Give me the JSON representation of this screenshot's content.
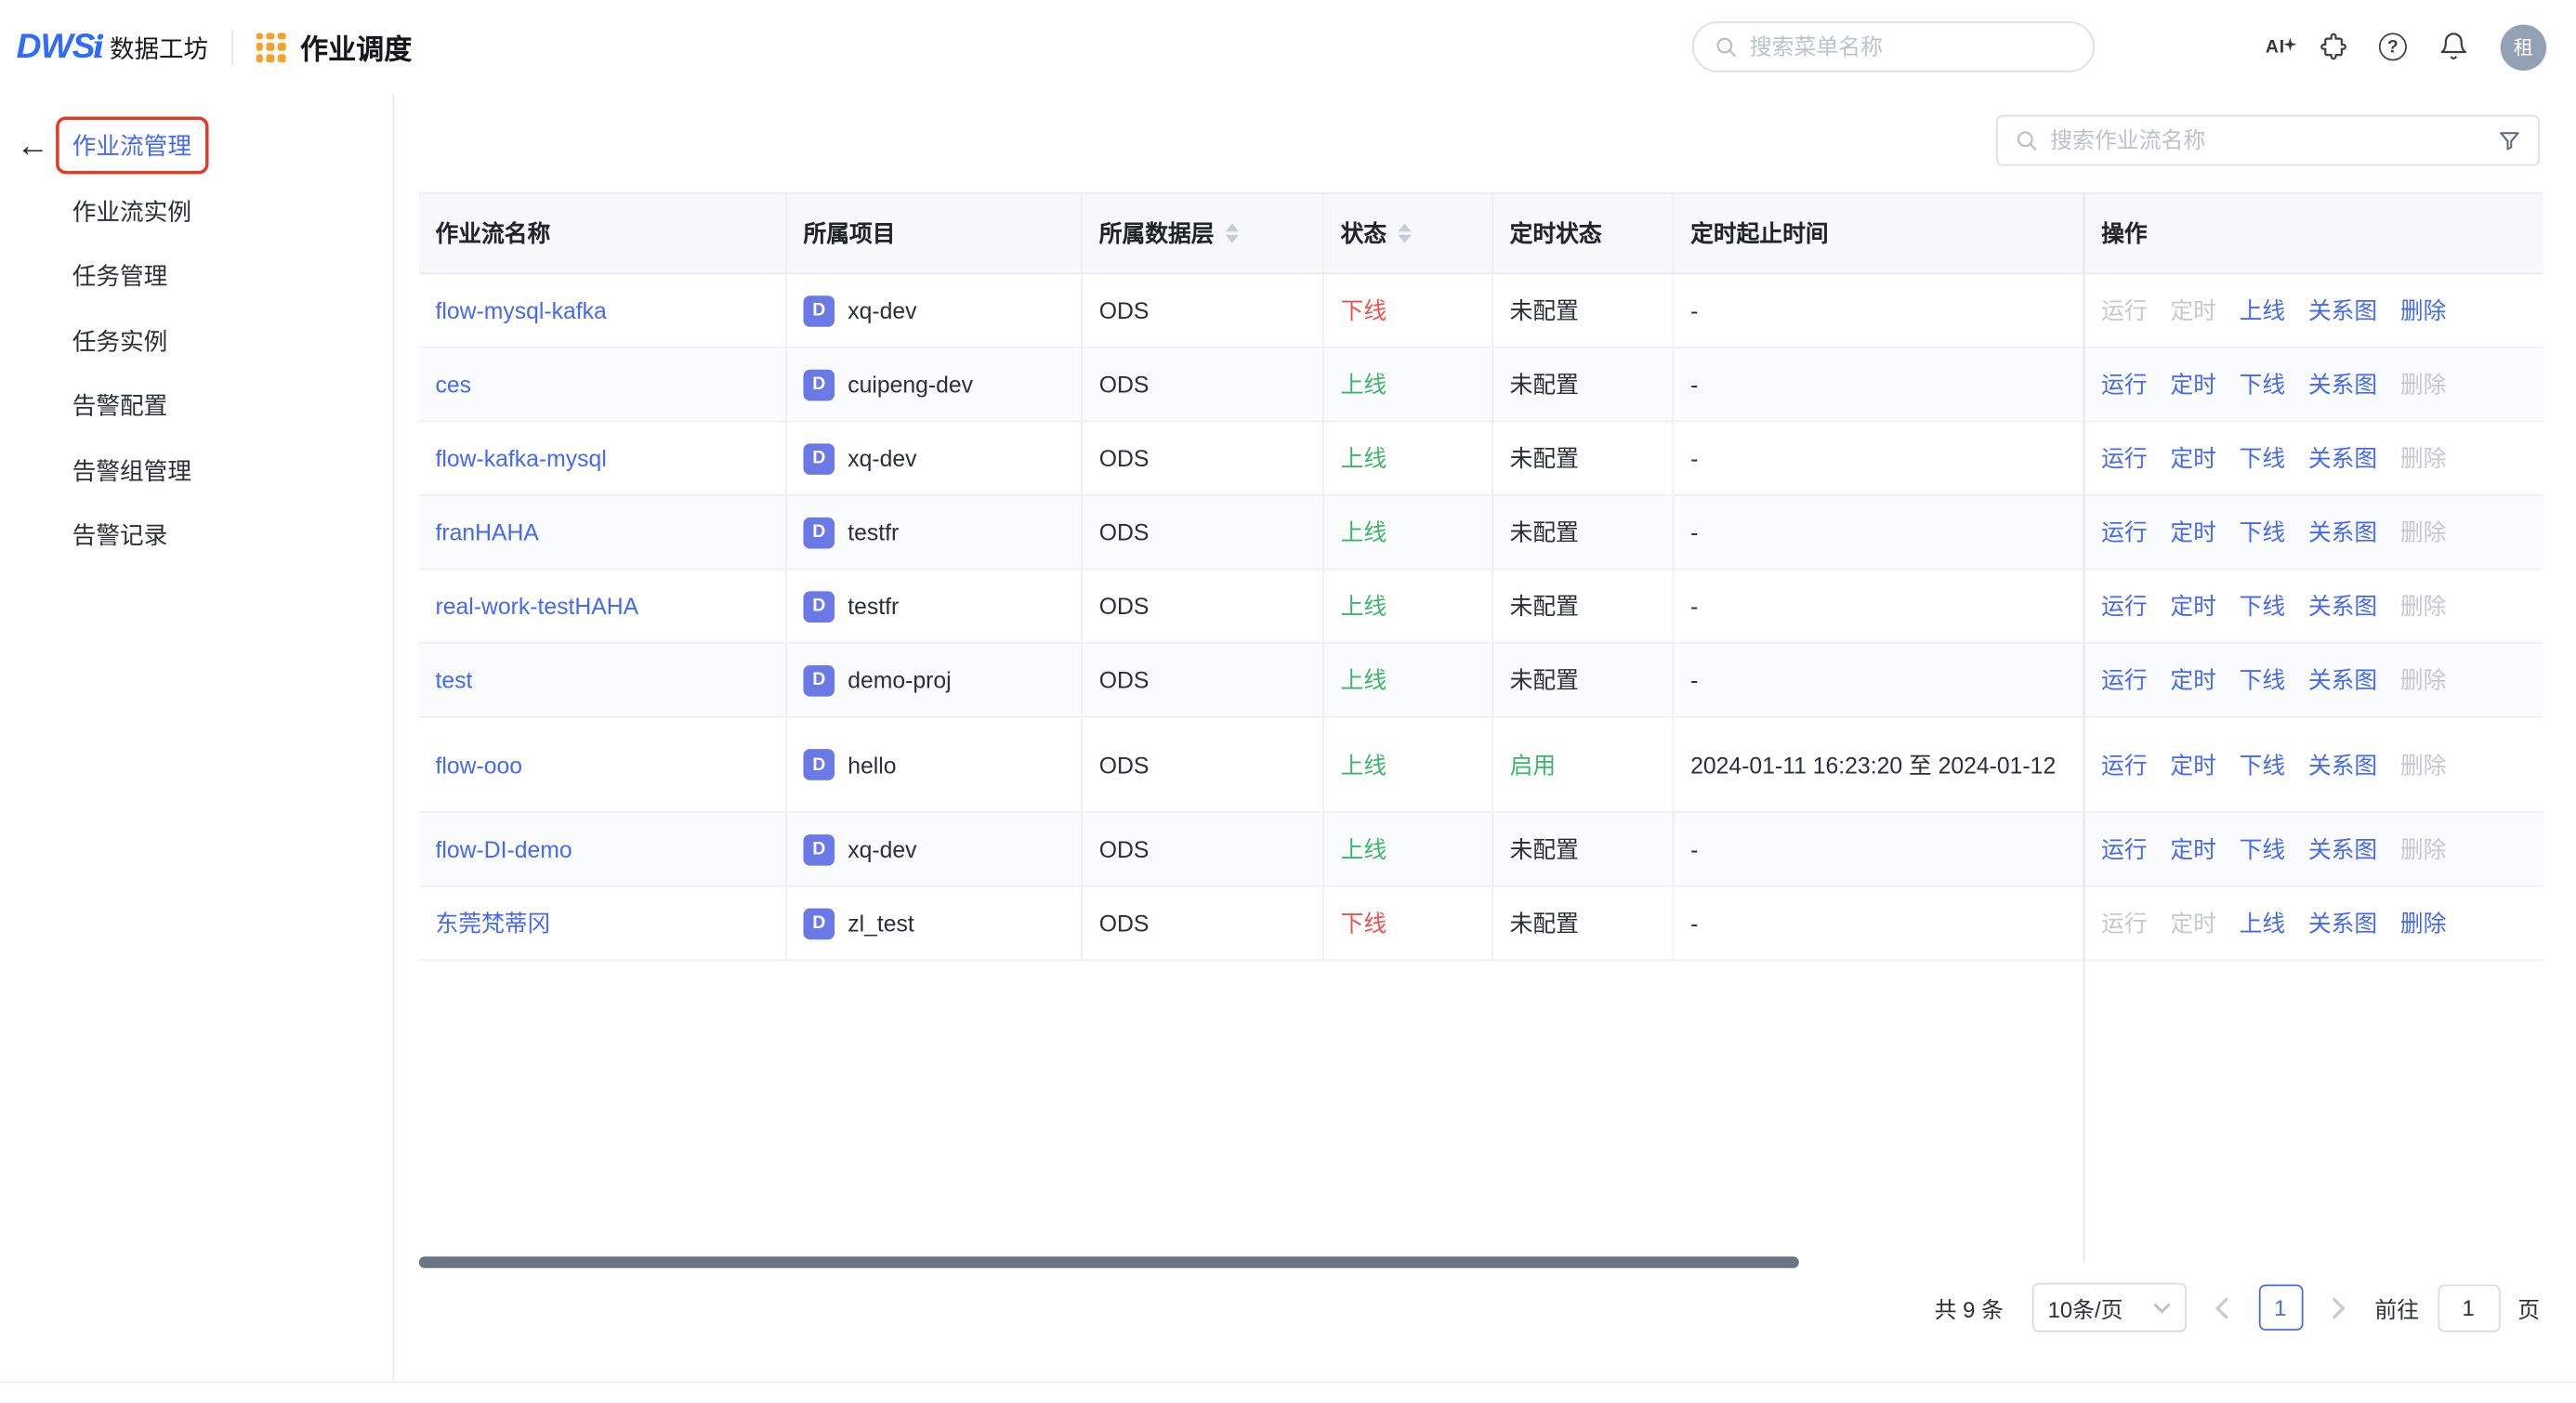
{
  "colors": {
    "accent_blue": "#4569f1",
    "status_red": "#f1504a",
    "status_green": "#3cb768",
    "badge_blue": "#6b79e6",
    "highlight_red": "#e03c2a",
    "grid_orange": "#f7a226"
  },
  "icons": {
    "back_arrow": "←",
    "question_mark": "?",
    "ai_badge": "AI",
    "project_badge": "D"
  },
  "header": {
    "logo": "DWS",
    "logo_i": "i",
    "brand": "数据工坊",
    "app_title": "作业调度",
    "search_placeholder": "搜索菜单名称",
    "avatar": "租"
  },
  "sidebar": {
    "items": [
      {
        "label": "作业流管理",
        "active": true
      },
      {
        "label": "作业流实例",
        "active": false
      },
      {
        "label": "任务管理",
        "active": false
      },
      {
        "label": "任务实例",
        "active": false
      },
      {
        "label": "告警配置",
        "active": false
      },
      {
        "label": "告警组管理",
        "active": false
      },
      {
        "label": "告警记录",
        "active": false
      }
    ]
  },
  "workflow_toolbar": {
    "search_placeholder": "搜索作业流名称"
  },
  "table": {
    "columns": [
      {
        "label": "作业流名称",
        "sortable": false
      },
      {
        "label": "所属项目",
        "sortable": false
      },
      {
        "label": "所属数据层",
        "sortable": true
      },
      {
        "label": "状态",
        "sortable": true
      },
      {
        "label": "定时状态",
        "sortable": false
      },
      {
        "label": "定时起止时间",
        "sortable": false
      },
      {
        "label": "操作",
        "sortable": false
      }
    ],
    "rows": [
      {
        "name": "flow-mysql-kafka",
        "project": "xq-dev",
        "layer": "ODS",
        "status": "下线",
        "schedule_status": "未配置",
        "schedule_time": "-",
        "actions": [
          {
            "label": "运行",
            "enabled": false
          },
          {
            "label": "定时",
            "enabled": false
          },
          {
            "label": "上线",
            "enabled": true
          },
          {
            "label": "关系图",
            "enabled": true
          },
          {
            "label": "删除",
            "enabled": true
          }
        ]
      },
      {
        "name": "ces",
        "project": "cuipeng-dev",
        "layer": "ODS",
        "status": "上线",
        "schedule_status": "未配置",
        "schedule_time": "-",
        "actions": [
          {
            "label": "运行",
            "enabled": true
          },
          {
            "label": "定时",
            "enabled": true
          },
          {
            "label": "下线",
            "enabled": true
          },
          {
            "label": "关系图",
            "enabled": true
          },
          {
            "label": "删除",
            "enabled": false
          }
        ]
      },
      {
        "name": "flow-kafka-mysql",
        "project": "xq-dev",
        "layer": "ODS",
        "status": "上线",
        "schedule_status": "未配置",
        "schedule_time": "-",
        "actions": [
          {
            "label": "运行",
            "enabled": true
          },
          {
            "label": "定时",
            "enabled": true
          },
          {
            "label": "下线",
            "enabled": true
          },
          {
            "label": "关系图",
            "enabled": true
          },
          {
            "label": "删除",
            "enabled": false
          }
        ]
      },
      {
        "name": "franHAHA",
        "project": "testfr",
        "layer": "ODS",
        "status": "上线",
        "schedule_status": "未配置",
        "schedule_time": "-",
        "actions": [
          {
            "label": "运行",
            "enabled": true
          },
          {
            "label": "定时",
            "enabled": true
          },
          {
            "label": "下线",
            "enabled": true
          },
          {
            "label": "关系图",
            "enabled": true
          },
          {
            "label": "删除",
            "enabled": false
          }
        ]
      },
      {
        "name": "real-work-testHAHA",
        "project": "testfr",
        "layer": "ODS",
        "status": "上线",
        "schedule_status": "未配置",
        "schedule_time": "-",
        "actions": [
          {
            "label": "运行",
            "enabled": true
          },
          {
            "label": "定时",
            "enabled": true
          },
          {
            "label": "下线",
            "enabled": true
          },
          {
            "label": "关系图",
            "enabled": true
          },
          {
            "label": "删除",
            "enabled": false
          }
        ]
      },
      {
        "name": "test",
        "project": "demo-proj",
        "layer": "ODS",
        "status": "上线",
        "schedule_status": "未配置",
        "schedule_time": "-",
        "actions": [
          {
            "label": "运行",
            "enabled": true
          },
          {
            "label": "定时",
            "enabled": true
          },
          {
            "label": "下线",
            "enabled": true
          },
          {
            "label": "关系图",
            "enabled": true
          },
          {
            "label": "删除",
            "enabled": false
          }
        ]
      },
      {
        "name": "flow-ooo",
        "project": "hello",
        "layer": "ODS",
        "status": "上线",
        "schedule_status": "启用",
        "schedule_time": "2024-01-11 16:23:20 至 2024-01-12",
        "actions": [
          {
            "label": "运行",
            "enabled": true
          },
          {
            "label": "定时",
            "enabled": true
          },
          {
            "label": "下线",
            "enabled": true
          },
          {
            "label": "关系图",
            "enabled": true
          },
          {
            "label": "删除",
            "enabled": false
          }
        ]
      },
      {
        "name": "flow-DI-demo",
        "project": "xq-dev",
        "layer": "ODS",
        "status": "上线",
        "schedule_status": "未配置",
        "schedule_time": "-",
        "actions": [
          {
            "label": "运行",
            "enabled": true
          },
          {
            "label": "定时",
            "enabled": true
          },
          {
            "label": "下线",
            "enabled": true
          },
          {
            "label": "关系图",
            "enabled": true
          },
          {
            "label": "删除",
            "enabled": false
          }
        ]
      },
      {
        "name": "东莞梵蒂冈",
        "project": "zl_test",
        "layer": "ODS",
        "status": "下线",
        "schedule_status": "未配置",
        "schedule_time": "-",
        "actions": [
          {
            "label": "运行",
            "enabled": false
          },
          {
            "label": "定时",
            "enabled": false
          },
          {
            "label": "上线",
            "enabled": true
          },
          {
            "label": "关系图",
            "enabled": true
          },
          {
            "label": "删除",
            "enabled": true
          }
        ]
      }
    ]
  },
  "pagination": {
    "total": "共 9 条",
    "page_size": "10条/页",
    "current": "1",
    "goto_label": "前往",
    "goto_value": "1",
    "page_unit": "页"
  }
}
